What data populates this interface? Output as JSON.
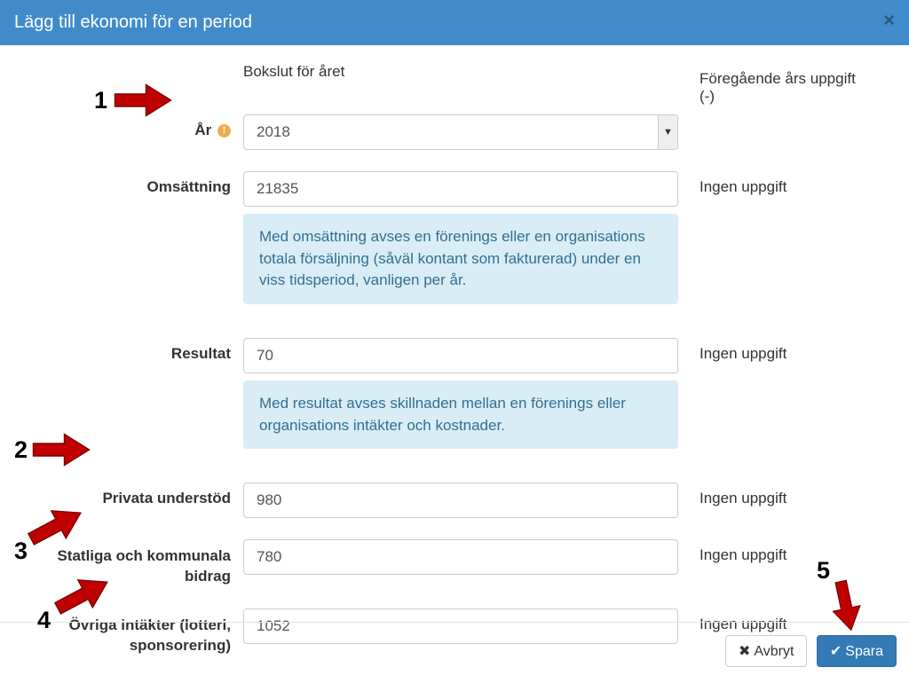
{
  "header": {
    "title": "Lägg till ekonomi för en period",
    "close": "×"
  },
  "columns": {
    "field_header": "Bokslut för året",
    "side_header": "Föregående års uppgift (-)"
  },
  "labels": {
    "year": "År",
    "turnover": "Omsättning",
    "result": "Resultat",
    "private_support": "Privata understöd",
    "gov_grants": "Statliga och kommunala bidrag",
    "other_income": "Övriga intäkter (lotteri, sponsorering)"
  },
  "values": {
    "year": "2018",
    "turnover": "21835",
    "result": "70",
    "private_support": "980",
    "gov_grants": "780",
    "other_income": "1052"
  },
  "helps": {
    "turnover": "Med omsättning avses en förenings eller en organisations totala försäljning (såväl kontant som fakturerad) under en viss tidsperiod, vanligen per år.",
    "result": "Med resultat avses skillnaden mellan en förenings eller organisations intäkter och kostnader."
  },
  "side": {
    "no_info": "Ingen uppgift"
  },
  "footer": {
    "cancel": "Avbryt",
    "save": "Spara"
  },
  "icons": {
    "warning": "!",
    "cancel": "✖",
    "save": "✔",
    "caret": "▼"
  },
  "callouts": {
    "n1": "1",
    "n2": "2",
    "n3": "3",
    "n4": "4",
    "n5": "5"
  },
  "colors": {
    "header_bg": "#428bca",
    "info_bg": "#d9edf7",
    "info_text": "#31708f",
    "primary": "#337ab7",
    "arrow_fill": "#c00000",
    "arrow_stroke": "#7a0000"
  }
}
